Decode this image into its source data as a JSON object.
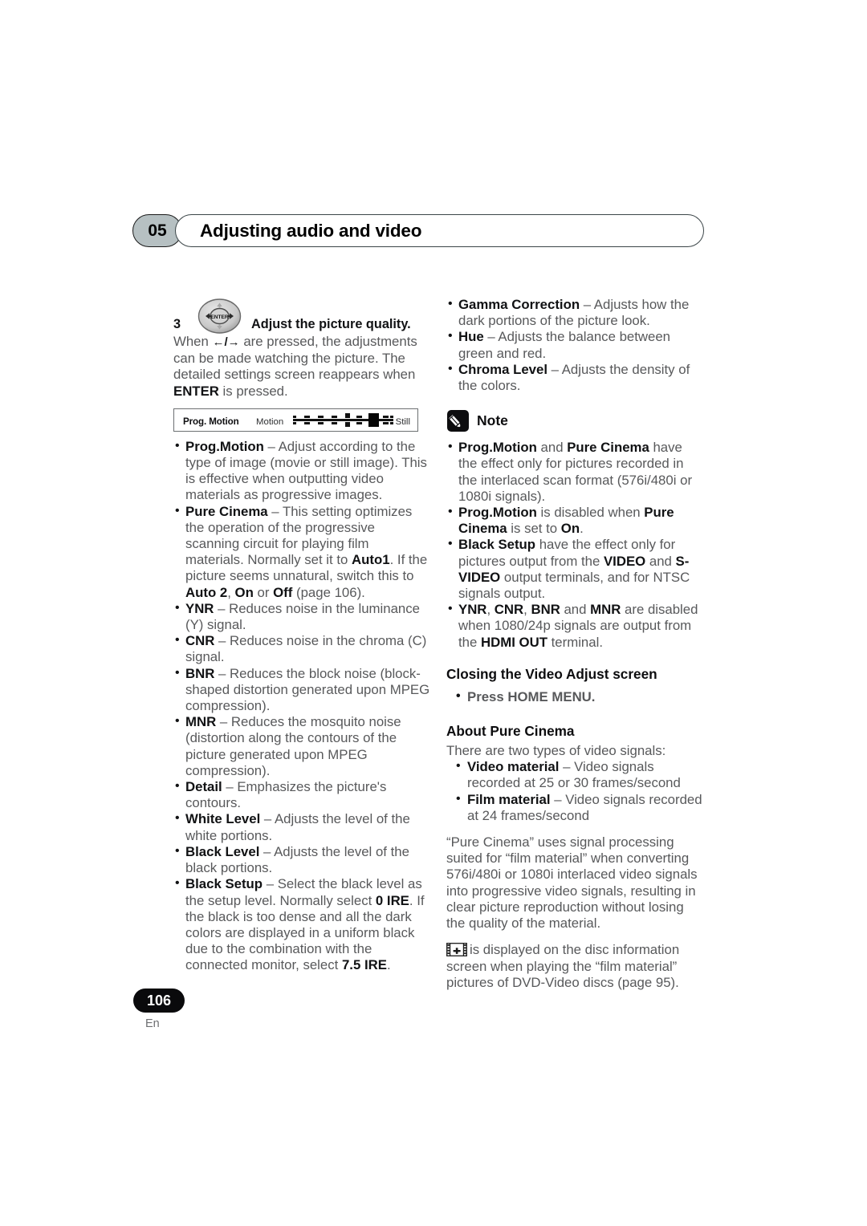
{
  "header": {
    "chapter_number": "05",
    "title": "Adjusting audio and video"
  },
  "step": {
    "number": "3",
    "icon": "dpad-enter-icon",
    "label": "Adjust the picture quality.",
    "body_before": "When ",
    "arrows": "←/→",
    "body_mid": " are pressed, the adjustments can be made watching the picture. The detailed settings screen reappears when ",
    "enter": "ENTER",
    "body_after": " is pressed."
  },
  "osd": {
    "setting_name": "Prog. Motion",
    "left_label": "Motion",
    "right_label": "Still"
  },
  "left_bullets": [
    {
      "term": "Prog.Motion",
      "text": " – Adjust according to the type of image (movie or still image). This is effective when outputting video materials as progressive images."
    },
    {
      "term": "Pure Cinema",
      "text": " – This setting optimizes the operation of the progressive scanning circuit for playing film materials. Normally set it to ",
      "b1": "Auto1",
      "text2": ". If the picture seems unnatural, switch this to ",
      "b2": "Auto 2",
      "text3": ", ",
      "b3": "On",
      "text4": " or ",
      "b4": "Off",
      "text5": " (page 106)."
    },
    {
      "term": "YNR",
      "text": " – Reduces noise in the luminance (Y) signal."
    },
    {
      "term": "CNR",
      "text": " – Reduces noise in the chroma (C) signal."
    },
    {
      "term": "BNR",
      "text": " – Reduces the block noise (block-shaped distortion generated upon MPEG compression)."
    },
    {
      "term": "MNR",
      "text": " – Reduces the mosquito noise (distortion along the contours of the picture generated upon MPEG compression)."
    },
    {
      "term": "Detail",
      "text": " – Emphasizes the picture's contours."
    },
    {
      "term": "White Level",
      "text": " – Adjusts the level of the white portions."
    },
    {
      "term": "Black Level",
      "text": " – Adjusts the level of the black portions."
    },
    {
      "term": "Black Setup",
      "text": " – Select the black level as the setup level. Normally select ",
      "b1": "0 IRE",
      "text2": ". If the black is too dense and all the dark colors are displayed in a uniform black due to the combination with the connected monitor, select ",
      "b2": "7.5 IRE",
      "text3": "."
    }
  ],
  "right_bullets": [
    {
      "term": "Gamma Correction",
      "text": " – Adjusts how the dark portions of the picture look."
    },
    {
      "term": "Hue",
      "text": " – Adjusts the balance between green and red."
    },
    {
      "term": "Chroma Level",
      "text": " – Adjusts the density of the colors."
    }
  ],
  "note": {
    "icon": "pencil-icon",
    "title": "Note",
    "items": [
      {
        "b1": "Prog.Motion",
        "t1": " and ",
        "b2": "Pure Cinema",
        "t2": " have the effect only for pictures recorded in the interlaced scan format (576i/480i or 1080i signals)."
      },
      {
        "b1": "Prog.Motion",
        "t1": " is disabled when ",
        "b2": "Pure Cinema",
        "t2": " is set to ",
        "b3": "On",
        "t3": "."
      },
      {
        "b1": "Black Setup",
        "t1": " have the effect only for pictures output from the ",
        "b2": "VIDEO",
        "t2": " and ",
        "b3": "S-VIDEO",
        "t3": " output terminals, and for NTSC signals output."
      },
      {
        "b1": "YNR",
        "t1": ", ",
        "b2": "CNR",
        "t2": ", ",
        "b3": "BNR",
        "t3": " and ",
        "b4": "MNR",
        "t4": " are disabled when 1080/24p signals are output from the ",
        "b5": "HDMI OUT",
        "t5": " terminal."
      }
    ]
  },
  "closing": {
    "heading": "Closing the Video Adjust screen",
    "bullet": "Press HOME MENU."
  },
  "about": {
    "heading": "About Pure Cinema",
    "intro": "There are two types of video signals:",
    "bullets": [
      {
        "term": "Video material",
        "text": " – Video signals recorded at 25 or 30 frames/second"
      },
      {
        "term": "Film material",
        "text": " – Video signals recorded at 24 frames/second"
      }
    ],
    "paragraph": "“Pure Cinema” uses signal processing suited for “film material” when converting 576i/480i or 1080i interlaced video signals into progressive video signals, resulting in clear picture reproduction without losing the quality of the material.",
    "film_icon": "film-strip-icon",
    "film_paragraph": "is displayed on the disc information screen when playing the “film material” pictures of DVD-Video discs (page 95)."
  },
  "footer": {
    "page_number": "106",
    "language": "En"
  }
}
